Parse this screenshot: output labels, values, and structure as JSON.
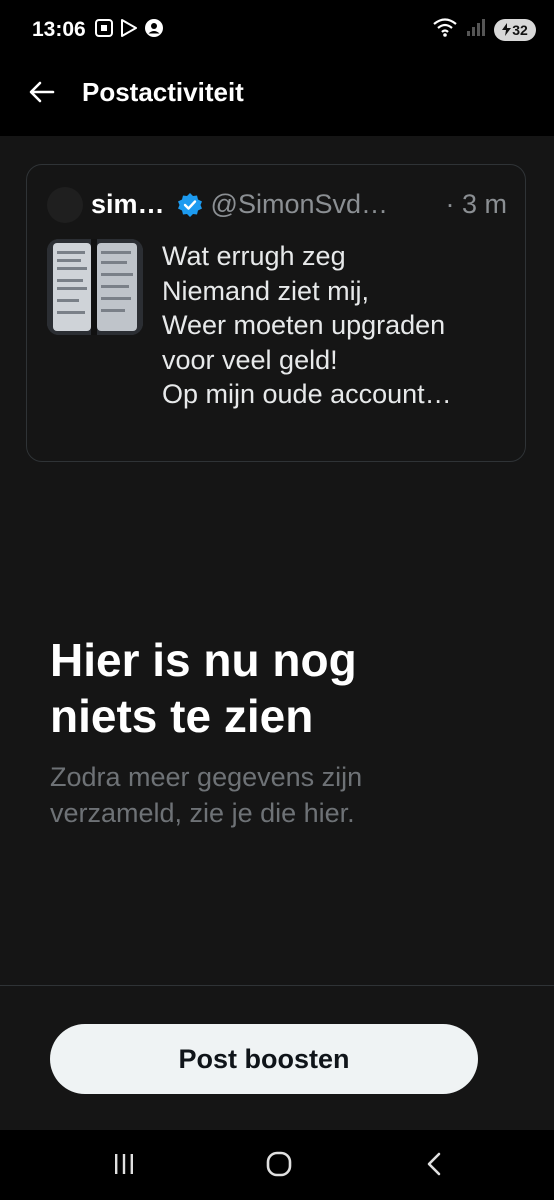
{
  "status_bar": {
    "time": "13:06",
    "battery_level": "32",
    "icons_left": [
      "screenshot-icon",
      "play-store-icon",
      "account-circle-icon"
    ],
    "icons_right": [
      "wifi-icon",
      "signal-icon",
      "battery-icon"
    ]
  },
  "header": {
    "back_icon": "arrow-left-icon",
    "title": "Postactiviteit"
  },
  "tweet": {
    "author_name": "sim…",
    "verified": true,
    "handle": "@SimonSvd…",
    "time": "· 3 m",
    "text_lines": [
      "Wat errugh zeg",
      "Niemand ziet mij,",
      "Weer moeten upgraden",
      "voor veel geld!",
      "Op mijn oude account…"
    ]
  },
  "empty_state": {
    "title_line1": "Hier is nu nog",
    "title_line2": "niets te zien",
    "subtitle_line1": "Zodra meer gegevens zijn",
    "subtitle_line2": "verzameld, zie je die hier."
  },
  "boost_button": {
    "label": "Post boosten"
  },
  "nav_bar": {
    "items": [
      "recents-icon",
      "home-icon",
      "back-icon"
    ]
  },
  "colors": {
    "background": "#151515",
    "bars": "#000000",
    "verified_blue": "#1d9bf0",
    "secondary_text": "#6e7276",
    "button_bg": "#eff3f4"
  }
}
